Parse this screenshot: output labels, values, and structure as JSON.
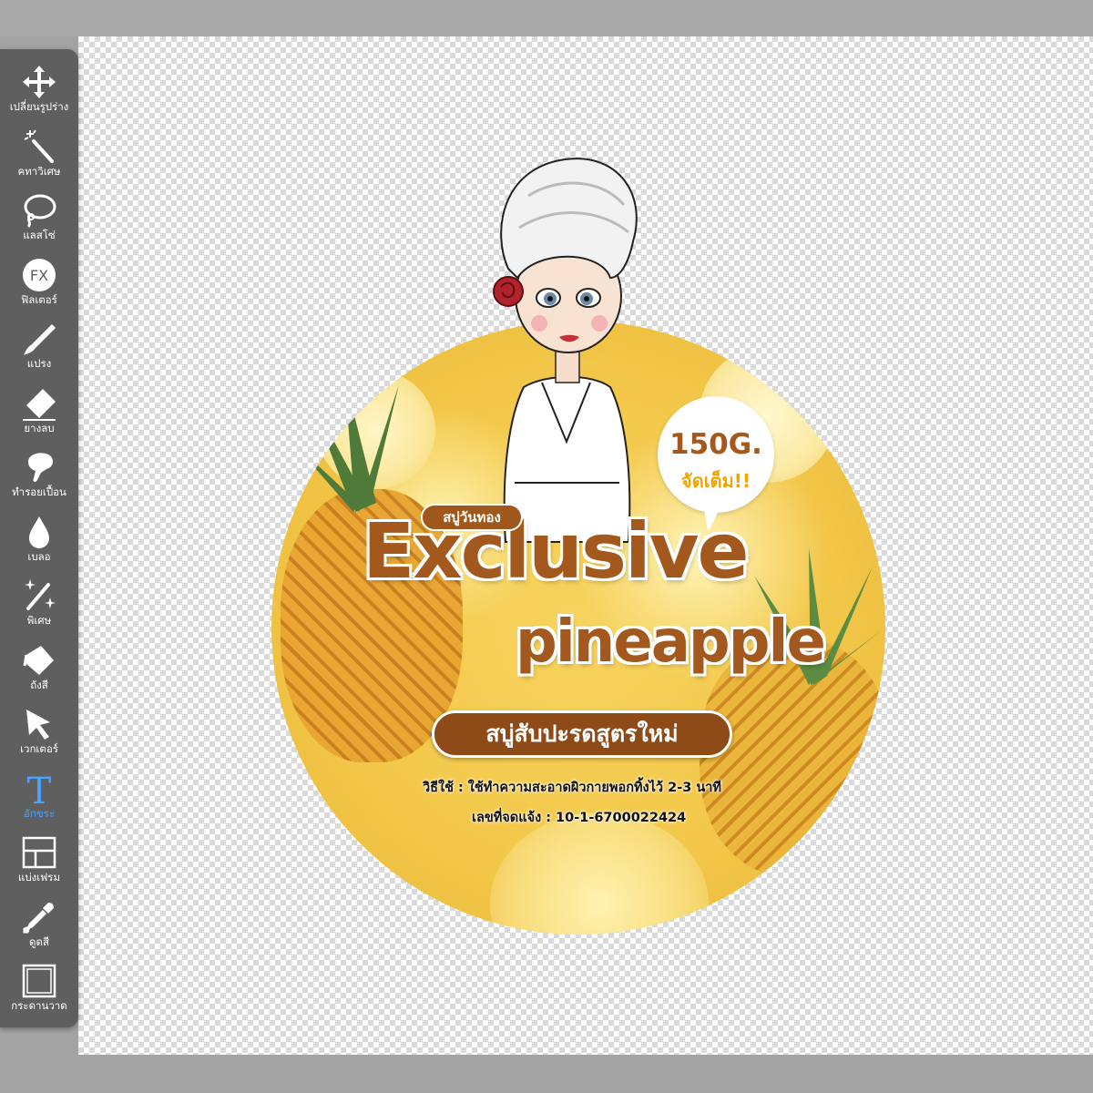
{
  "toolbar": {
    "tools": [
      {
        "label": "เปลี่ยนรูปร่าง",
        "icon": "move-arrows-icon"
      },
      {
        "label": "คทาวิเศษ",
        "icon": "magic-wand-icon"
      },
      {
        "label": "แลสโซ่",
        "icon": "lasso-icon"
      },
      {
        "label": "ฟิลเตอร์",
        "icon": "fx-filter-icon",
        "icon_text": "FX"
      },
      {
        "label": "แปรง",
        "icon": "brush-icon"
      },
      {
        "label": "ยางลบ",
        "icon": "eraser-icon"
      },
      {
        "label": "ทำรอยเปื้อน",
        "icon": "smudge-icon"
      },
      {
        "label": "เบลอ",
        "icon": "blur-drop-icon"
      },
      {
        "label": "พิเศษ",
        "icon": "special-effects-icon"
      },
      {
        "label": "ถังสี",
        "icon": "paint-bucket-icon"
      },
      {
        "label": "เวกเตอร์",
        "icon": "vector-pointer-icon"
      },
      {
        "label": "อักขระ",
        "icon": "text-tool-icon",
        "icon_text": "T",
        "active": true
      },
      {
        "label": "แบ่งเฟรม",
        "icon": "frame-divider-icon"
      },
      {
        "label": "ดูดสี",
        "icon": "eyedropper-icon"
      },
      {
        "label": "กระดานวาด",
        "icon": "canvas-icon"
      }
    ],
    "active_color": "#4aa3ff"
  },
  "artwork": {
    "brand_badge": "สบู่วันทอง",
    "title_line1": "Exclusive",
    "title_line2": "pineapple",
    "tagline": "สบู่สับปะรดสูตรใหม่",
    "usage": "วิธีใช้ : ใช้ทำความสะอาดผิวกายพอกทิ้งไว้ 2-3 นาที",
    "registration": "เลขที่จดแจ้ง : 10-1-6700022424",
    "bubble": {
      "weight": "150G.",
      "full": "จัดเต็ม!!"
    },
    "colors": {
      "brown": "#a3591d",
      "label_yellow": "#f3c84a",
      "accent_orange": "#f0a500"
    }
  }
}
